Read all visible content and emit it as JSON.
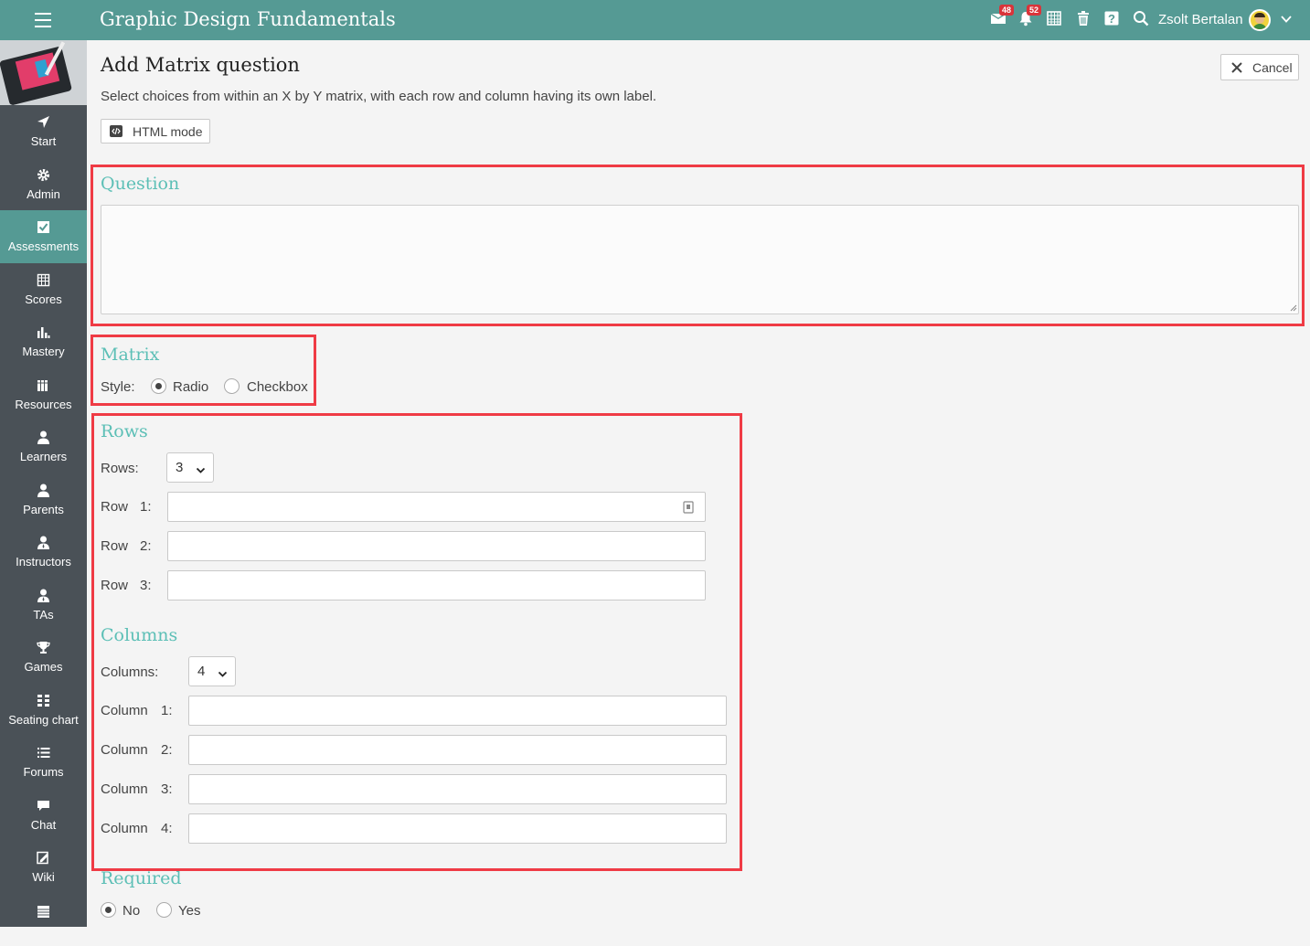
{
  "header": {
    "title": "Graphic Design Fundamentals",
    "mail_badge": "48",
    "notif_badge": "52",
    "user_name": "Zsolt Bertalan"
  },
  "sidebar": {
    "items": [
      {
        "label": "Start",
        "icon": "paper-plane-icon"
      },
      {
        "label": "Admin",
        "icon": "gear-icon"
      },
      {
        "label": "Assessments",
        "icon": "checkbox-icon",
        "active": true
      },
      {
        "label": "Scores",
        "icon": "gradebook-icon"
      },
      {
        "label": "Mastery",
        "icon": "bar-chart-icon"
      },
      {
        "label": "Resources",
        "icon": "books-icon"
      },
      {
        "label": "Learners",
        "icon": "person-icon"
      },
      {
        "label": "Parents",
        "icon": "person-icon"
      },
      {
        "label": "Instructors",
        "icon": "instructor-icon"
      },
      {
        "label": "TAs",
        "icon": "ta-icon"
      },
      {
        "label": "Games",
        "icon": "trophy-icon"
      },
      {
        "label": "Seating chart",
        "icon": "grid-icon"
      },
      {
        "label": "Forums",
        "icon": "list-icon"
      },
      {
        "label": "Chat",
        "icon": "chat-bubble-icon"
      },
      {
        "label": "Wiki",
        "icon": "edit-icon"
      }
    ]
  },
  "page": {
    "title": "Add Matrix question",
    "description": "Select choices from within an X by Y matrix, with each row and column having its own label.",
    "cancel_label": "Cancel",
    "html_mode_label": "HTML mode"
  },
  "question": {
    "title": "Question",
    "value": ""
  },
  "matrix": {
    "title": "Matrix",
    "style_label": "Style:",
    "options": [
      "Radio",
      "Checkbox"
    ],
    "selected": "Radio"
  },
  "rows": {
    "title": "Rows",
    "count_label": "Rows:",
    "count_value": "3",
    "items": [
      {
        "label": "Row",
        "num": "1:",
        "value": ""
      },
      {
        "label": "Row",
        "num": "2:",
        "value": ""
      },
      {
        "label": "Row",
        "num": "3:",
        "value": ""
      }
    ]
  },
  "columns": {
    "title": "Columns",
    "count_label": "Columns:",
    "count_value": "4",
    "items": [
      {
        "label": "Column",
        "num": "1:",
        "value": ""
      },
      {
        "label": "Column",
        "num": "2:",
        "value": ""
      },
      {
        "label": "Column",
        "num": "3:",
        "value": ""
      },
      {
        "label": "Column",
        "num": "4:",
        "value": ""
      }
    ]
  },
  "required": {
    "title": "Required",
    "options": [
      "No",
      "Yes"
    ],
    "selected": "No"
  },
  "colors": {
    "topbar": "#559a94",
    "sidebar": "#4a5157",
    "accent": "#5cbfb6",
    "highlight": "#ef3b45",
    "badge": "#d9343a"
  }
}
